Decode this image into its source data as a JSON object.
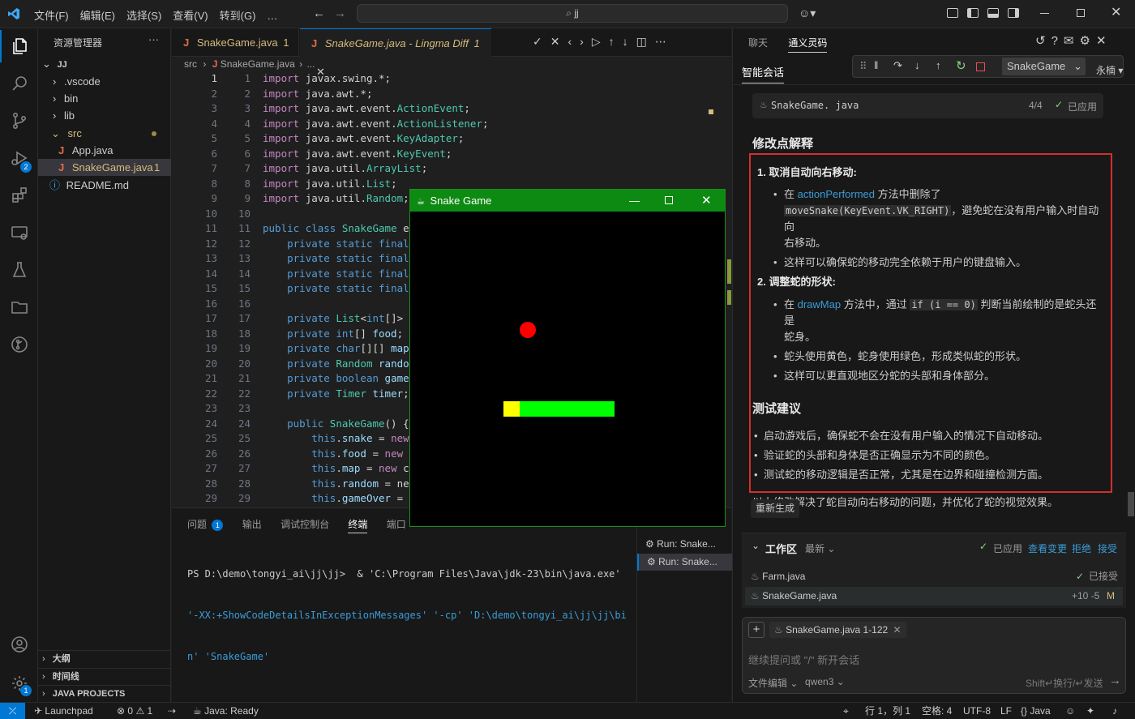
{
  "titlebar": {
    "menus": [
      "文件(F)",
      "编辑(E)",
      "选择(S)",
      "查看(V)",
      "转到(G)",
      "…"
    ],
    "search": "jj"
  },
  "activity": {
    "icons": [
      "files-icon",
      "search-icon",
      "source-control-icon",
      "run-debug-icon",
      "extensions-icon",
      "remote-explorer-icon",
      "testing-icon",
      "folder-icon",
      "git-graph-icon"
    ],
    "debug_badge": "2",
    "account_icon": "account-icon",
    "settings_badge": "1"
  },
  "explorer": {
    "title": "资源管理器",
    "more": "···",
    "root": "JJ",
    "items": [
      {
        "label": ".vscode",
        "kind": "folder"
      },
      {
        "label": "bin",
        "kind": "folder"
      },
      {
        "label": "lib",
        "kind": "folder"
      },
      {
        "label": "src",
        "kind": "folder-open"
      },
      {
        "label": "App.java",
        "kind": "java"
      },
      {
        "label": "SnakeGame.java",
        "kind": "java",
        "badge": "1"
      },
      {
        "label": "README.md",
        "kind": "info"
      }
    ],
    "sections": [
      "大纲",
      "时间线",
      "JAVA PROJECTS"
    ]
  },
  "editor": {
    "tabs": [
      {
        "label": "SnakeGame.java",
        "badge": "1"
      },
      {
        "label": "SnakeGame.java - Lingma Diff",
        "badge": "1"
      }
    ],
    "breadcrumb": [
      "src",
      "SnakeGame.java",
      "..."
    ],
    "lines": [
      "import javax.swing.*;",
      "import java.awt.*;",
      "import java.awt.event.ActionEvent;",
      "import java.awt.event.ActionListener;",
      "import java.awt.event.KeyAdapter;",
      "import java.awt.event.KeyEvent;",
      "import java.util.ArrayList;",
      "import java.util.List;",
      "import java.util.Random;",
      "",
      "public class SnakeGame e",
      "    private static final",
      "    private static final",
      "    private static final",
      "    private static final",
      "",
      "    private List<int[]>",
      "    private int[] food;",
      "    private char[][] map",
      "    private Random rando",
      "    private boolean game",
      "    private Timer timer;",
      "",
      "    public SnakeGame() {",
      "        this.snake = new",
      "        this.food = new",
      "        this.map = new c",
      "        this.random = ne",
      "        this.gameOver ="
    ]
  },
  "panel": {
    "tabs": [
      "问题",
      "输出",
      "调试控制台",
      "终端",
      "端口"
    ],
    "problems_badge": "1",
    "terminal_lines": [
      "PS D:\\demo\\tongyi_ai\\jj\\jj>  & 'C:\\Program Files\\Java\\jdk-23\\bin\\java.exe'",
      "'-XX:+ShowCodeDetailsInExceptionMessages' '-cp' 'D:\\demo\\tongyi_ai\\jj\\jj\\bi",
      "n' 'SnakeGame'"
    ],
    "terminals": [
      "Run: Snake...",
      "Run: Snake..."
    ]
  },
  "snake_window": {
    "title": "Snake Game",
    "food_color": "#ff0000",
    "head_color": "#ffff00",
    "body_color": "#00ff00"
  },
  "ai": {
    "tabs": [
      "聊天",
      "通义灵码"
    ],
    "session_label": "智能会话",
    "debug_config": "SnakeGame",
    "user_name": "永楠",
    "file_card": {
      "name": "SnakeGame. java",
      "count": "4/4",
      "status": "已应用"
    },
    "heading1": "修改点解释",
    "point1_title": "1. 取消自动向右移动:",
    "p1_a_pre": "在 ",
    "p1_a_link": "actionPerformed",
    "p1_a_post": " 方法中删除了",
    "p1_a_code": "moveSnake(KeyEvent.VK_RIGHT)",
    "p1_a_tail": "，避免蛇在没有用户输入时自动向",
    "p1_a_tail2": "右移动。",
    "p1_b": "这样可以确保蛇的移动完全依赖于用户的键盘输入。",
    "point2_title": "2. 调整蛇的形状:",
    "p2_a_pre": "在 ",
    "p2_a_link": "drawMap",
    "p2_a_mid": " 方法中，通过 ",
    "p2_a_code": "if (i == 0)",
    "p2_a_tail": " 判断当前绘制的是蛇头还是",
    "p2_a_tail2": "蛇身。",
    "p2_b": "蛇头使用黄色，蛇身使用绿色，形成类似蛇的形状。",
    "p2_c": "这样可以更直观地区分蛇的头部和身体部分。",
    "heading2": "测试建议",
    "tests": [
      "启动游戏后，确保蛇不会在没有用户输入的情况下自动移动。",
      "验证蛇的头部和身体是否正确显示为不同的颜色。",
      "测试蛇的移动逻辑是否正常，尤其是在边界和碰撞检测方面。"
    ],
    "summary": "以上修改解决了蛇自动向右移动的问题，并优化了蛇的视觉效果。",
    "regen": "重新生成",
    "workspace": {
      "title": "工作区",
      "filter": "最新",
      "applied": "已应用",
      "view_changes": "查看变更",
      "reject": "拒绝",
      "accept": "接受",
      "files": [
        {
          "name": "Farm.java",
          "status": "已接受"
        },
        {
          "name": "SnakeGame.java",
          "diff": "+10 -5",
          "mark": "M"
        }
      ]
    },
    "input": {
      "chip": "SnakeGame.java 1-122",
      "placeholder": "继续提问或 \"/\" 新开会话",
      "mode": "文件编辑",
      "model": "qwen3",
      "send_hint": "Shift↵换行/↵发送"
    }
  },
  "status": {
    "launchpad": "Launchpad",
    "errors": "0",
    "warnings": "1",
    "java": "Java: Ready",
    "position": "行 1，列 1",
    "spaces": "空格: 4",
    "encoding": "UTF-8",
    "eol": "LF",
    "lang": "Java"
  }
}
